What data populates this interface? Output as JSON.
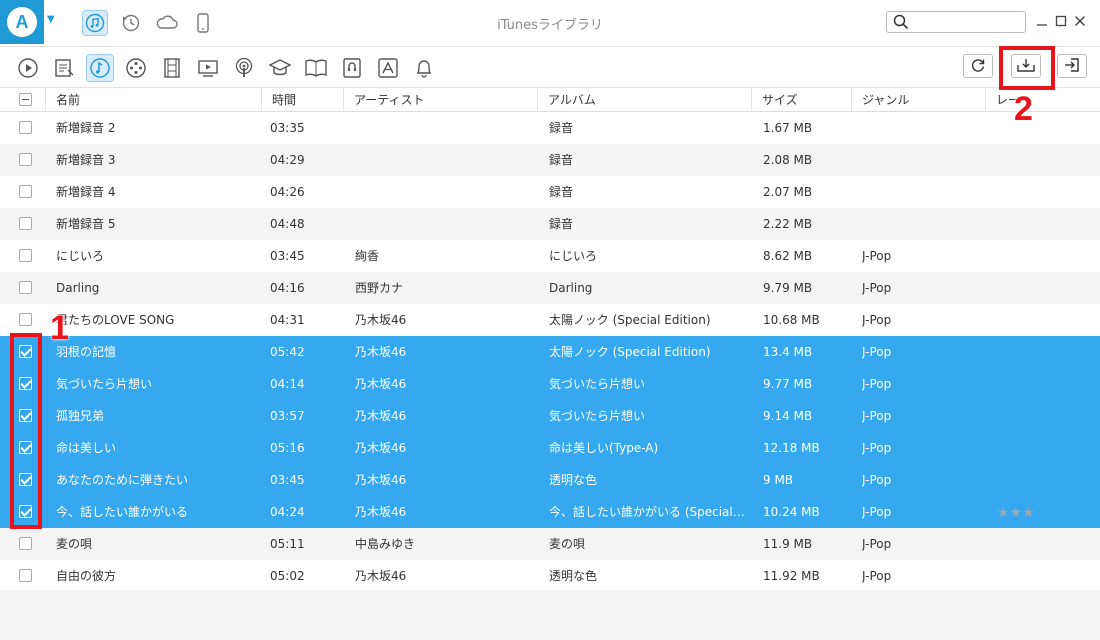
{
  "window": {
    "title": "iTunesライブラリ",
    "search_placeholder": ""
  },
  "logo": {
    "letter": "A"
  },
  "device_tabs": [
    {
      "name": "music",
      "active": true
    },
    {
      "name": "restore",
      "active": false
    },
    {
      "name": "icloud",
      "active": false
    },
    {
      "name": "phone",
      "active": false
    }
  ],
  "toolbar": {
    "categories": [
      "play",
      "playlist",
      "music",
      "games",
      "movies",
      "tv",
      "podcast",
      "itunes-u",
      "books",
      "audiobooks",
      "apps",
      "ringtones"
    ],
    "active_category": "music"
  },
  "annotations": {
    "callout_1": "1",
    "callout_2": "2"
  },
  "table": {
    "headers": [
      "名前",
      "時間",
      "アーティスト",
      "アルバム",
      "サイズ",
      "ジャンル",
      "レー"
    ],
    "rows": [
      {
        "name": "新増録音 2",
        "time": "03:35",
        "artist": "",
        "album": "録音",
        "size": "1.67 MB",
        "genre": "",
        "selected": false
      },
      {
        "name": "新増録音 3",
        "time": "04:29",
        "artist": "",
        "album": "録音",
        "size": "2.08 MB",
        "genre": "",
        "selected": false
      },
      {
        "name": "新増録音 4",
        "time": "04:26",
        "artist": "",
        "album": "録音",
        "size": "2.07 MB",
        "genre": "",
        "selected": false
      },
      {
        "name": "新増録音 5",
        "time": "04:48",
        "artist": "",
        "album": "録音",
        "size": "2.22 MB",
        "genre": "",
        "selected": false
      },
      {
        "name": "にじいろ",
        "time": "03:45",
        "artist": "絢香",
        "album": "にじいろ",
        "size": "8.62 MB",
        "genre": "J-Pop",
        "selected": false
      },
      {
        "name": "Darling",
        "time": "04:16",
        "artist": "西野カナ",
        "album": "Darling",
        "size": "9.79 MB",
        "genre": "J-Pop",
        "selected": false
      },
      {
        "name": "君たちのLOVE SONG",
        "time": "04:31",
        "artist": "乃木坂46",
        "album": "太陽ノック (Special Edition)",
        "size": "10.68 MB",
        "genre": "J-Pop",
        "selected": false
      },
      {
        "name": "羽根の記憶",
        "time": "05:42",
        "artist": "乃木坂46",
        "album": "太陽ノック (Special Edition)",
        "size": "13.4 MB",
        "genre": "J-Pop",
        "selected": true
      },
      {
        "name": "気づいたら片想い",
        "time": "04:14",
        "artist": "乃木坂46",
        "album": "気づいたら片想い",
        "size": "9.77 MB",
        "genre": "J-Pop",
        "selected": true
      },
      {
        "name": "孤独兄弟",
        "time": "03:57",
        "artist": "乃木坂46",
        "album": "気づいたら片想い",
        "size": "9.14 MB",
        "genre": "J-Pop",
        "selected": true
      },
      {
        "name": "命は美しい",
        "time": "05:16",
        "artist": "乃木坂46",
        "album": "命は美しい(Type-A)",
        "size": "12.18 MB",
        "genre": "J-Pop",
        "selected": true
      },
      {
        "name": "あなたのために弾きたい",
        "time": "03:45",
        "artist": "乃木坂46",
        "album": "透明な色",
        "size": "9 MB",
        "genre": "J-Pop",
        "selected": true
      },
      {
        "name": "今、話したい誰かがいる",
        "time": "04:24",
        "artist": "乃木坂46",
        "album": "今、話したい誰かがいる (Special Editi...",
        "size": "10.24 MB",
        "genre": "J-Pop",
        "selected": true,
        "rating": 3
      },
      {
        "name": "麦の唄",
        "time": "05:11",
        "artist": "中島みゆき",
        "album": "麦の唄",
        "size": "11.9 MB",
        "genre": "J-Pop",
        "selected": false
      },
      {
        "name": "自由の彼方",
        "time": "05:02",
        "artist": "乃木坂46",
        "album": "透明な色",
        "size": "11.92 MB",
        "genre": "J-Pop",
        "selected": false
      }
    ]
  },
  "colors": {
    "accent": "#1f9ad6",
    "selection": "#35a8f0",
    "annotation_red": "#e8141b"
  }
}
